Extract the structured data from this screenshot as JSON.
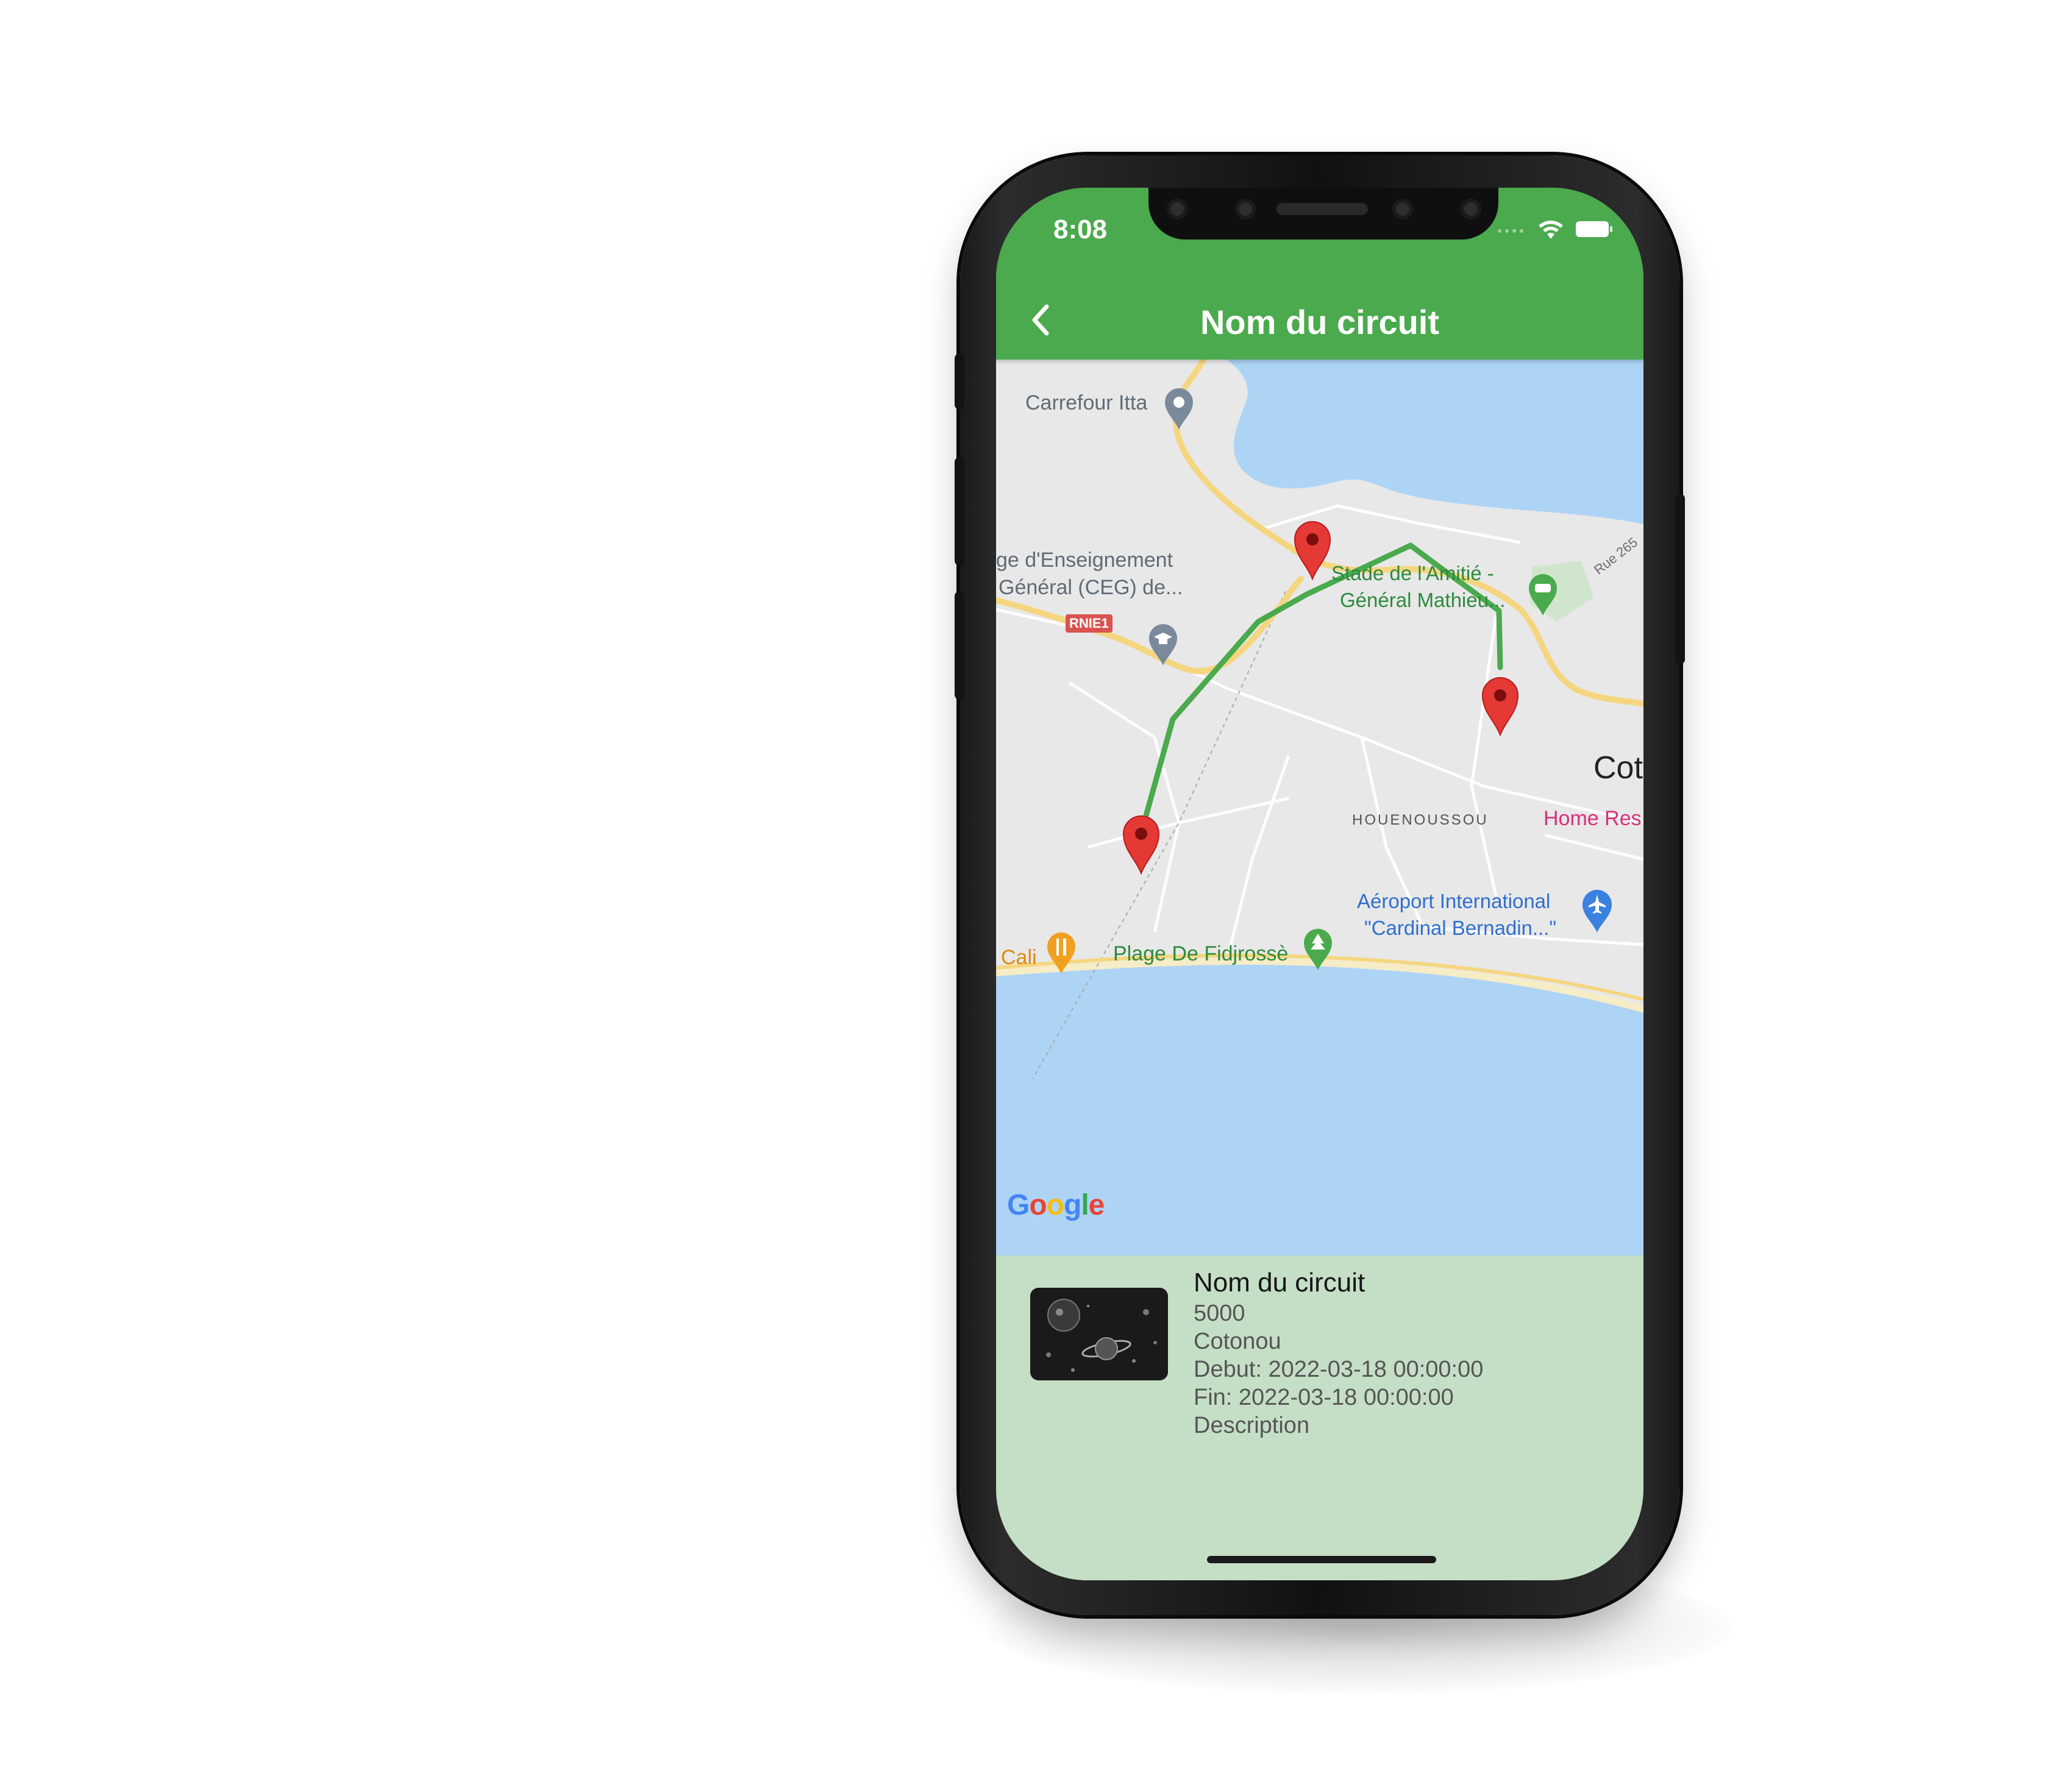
{
  "status_bar": {
    "time": "8:08"
  },
  "app_bar": {
    "title": "Nom du circuit"
  },
  "map": {
    "labels": {
      "carrefour": "Carrefour Itta",
      "ceg_line1": "ge d'Enseignement",
      "ceg_line2": "Général (CEG) de...",
      "road_rnie1": "RNIE1",
      "stade_line1": "Stade de l'Amitié -",
      "stade_line2": "Général Mathieu...",
      "rue": "Rue 265",
      "cot": "Cot",
      "houenoussou": "HOUENOUSSOU",
      "home_res": "Home Res",
      "aeroport_line1": "Aéroport International",
      "aeroport_line2": "\"Cardinal Bernadin...\"",
      "cali": "Cali",
      "plage": "Plage De Fidjrossè"
    },
    "attribution": {
      "G": "G",
      "o1": "o",
      "o2": "o",
      "g": "g",
      "l": "l",
      "e": "e"
    },
    "colors": {
      "water": "#aed4f5",
      "land": "#e8e8e8",
      "route": "#4aaa4d",
      "pin": "#e53935"
    }
  },
  "card": {
    "title": "Nom du circuit",
    "price": "5000",
    "city": "Cotonou",
    "start": "Debut: 2022-03-18 00:00:00",
    "end": "Fin: 2022-03-18 00:00:00",
    "description": "Description"
  },
  "colors": {
    "brand": "#4aaa4d",
    "card_bg": "#c5dfc6"
  }
}
